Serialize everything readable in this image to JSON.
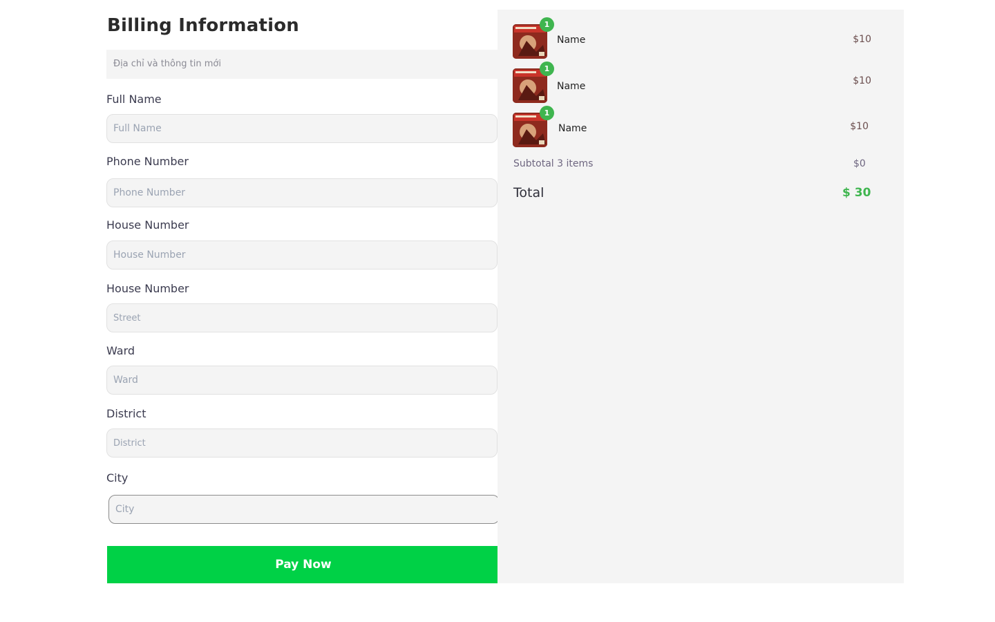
{
  "billing": {
    "title": "Billing Information",
    "address_select": "Địa chỉ và thông tin mới",
    "fields": [
      {
        "label": "Full Name",
        "placeholder": "Full Name"
      },
      {
        "label": "Phone Number",
        "placeholder": "Phone Number"
      },
      {
        "label": "House Number",
        "placeholder": "House Number"
      },
      {
        "label": "House Number",
        "placeholder": "Street"
      },
      {
        "label": "Ward",
        "placeholder": "Ward"
      },
      {
        "label": "District",
        "placeholder": "District"
      },
      {
        "label": "City",
        "placeholder": "City"
      }
    ],
    "pay_button": "Pay Now"
  },
  "summary": {
    "items": [
      {
        "name": "Name",
        "price": "$10",
        "quantity": "1",
        "icon": "product-thumbnail"
      },
      {
        "name": "Name",
        "price": "$10",
        "quantity": "1",
        "icon": "product-thumbnail"
      },
      {
        "name": "Name",
        "price": "$10",
        "quantity": "1",
        "icon": "product-thumbnail"
      }
    ],
    "subtotal_label": "Subtotal 3 items",
    "subtotal_value": "$0",
    "total_label": "Total",
    "total_value": "$ 30"
  },
  "colors": {
    "accent_green": "#00d146",
    "badge_green": "#3fb54f",
    "panel_bg": "#f4f4f4"
  }
}
